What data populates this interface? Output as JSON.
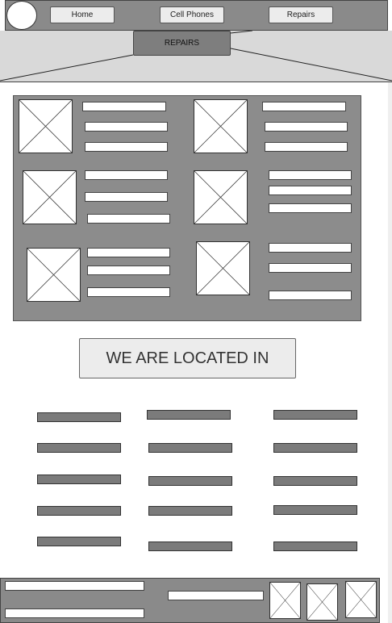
{
  "nav": {
    "items": [
      {
        "label": "Home"
      },
      {
        "label": "Cell Phones"
      },
      {
        "label": "Repairs"
      }
    ]
  },
  "hero": {
    "label": "REPAIRS"
  },
  "location": {
    "heading": "WE ARE LOCATED IN"
  },
  "icons": {
    "logo": "circle-logo-icon",
    "image_placeholder": "image-placeholder-icon"
  },
  "colors": {
    "panel": "#8c8c8c",
    "button": "#ececec",
    "dark_bar": "#7b7b7b"
  }
}
